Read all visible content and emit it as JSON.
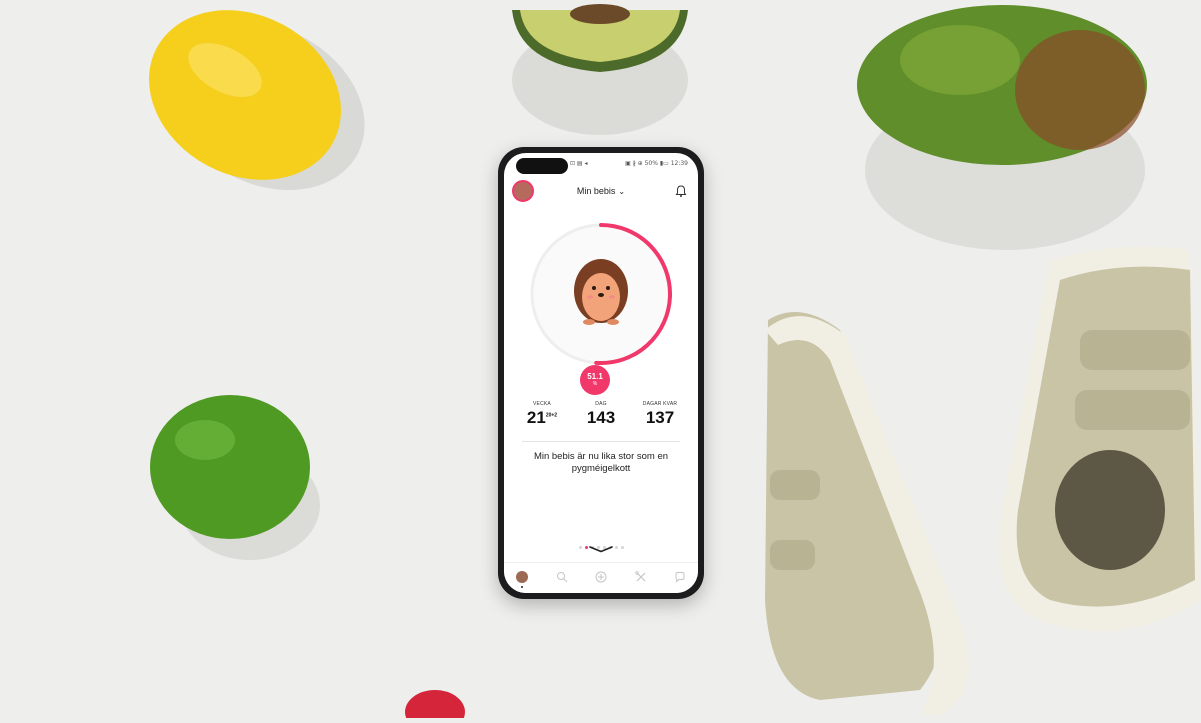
{
  "statusbar": {
    "left": "⊡ ▤ ◂",
    "right": "▣ ∦ ⊕ 50% ▮▭ 12:39"
  },
  "header": {
    "title": "Min bebis",
    "chevron": "⌄"
  },
  "progress": {
    "percent_label": "51.1",
    "percent_unit": "%",
    "fraction": 0.511
  },
  "stats": [
    {
      "label": "VECKA",
      "value": "21",
      "sup": "20+2"
    },
    {
      "label": "DAG",
      "value": "143"
    },
    {
      "label": "DAGAR KVAR",
      "value": "137"
    }
  ],
  "description": "Min bebis är nu lika stor som en pygméigelkott",
  "pager": {
    "count": 8,
    "active_index": 1
  },
  "nav": {
    "items": [
      {
        "icon": "home-avatar-icon",
        "active": true
      },
      {
        "icon": "search-icon",
        "active": false
      },
      {
        "icon": "add-icon",
        "active": false
      },
      {
        "icon": "tools-icon",
        "active": false
      },
      {
        "icon": "chat-icon",
        "active": false
      }
    ]
  },
  "colors": {
    "accent": "#f0386b",
    "background": "#eeeeec",
    "phone_frame": "#1c1c1e"
  }
}
